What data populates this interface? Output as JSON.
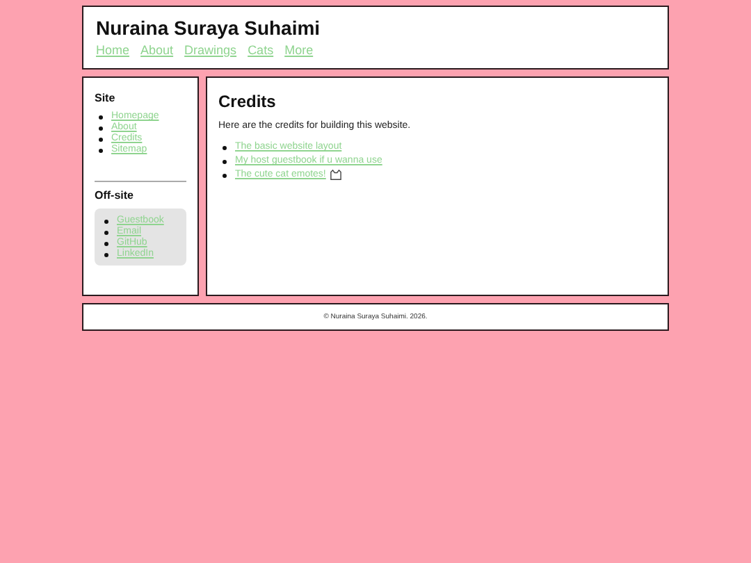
{
  "header": {
    "title": "Nuraina Suraya Suhaimi",
    "nav": [
      "Home",
      "About",
      "Drawings",
      "Cats",
      "More"
    ]
  },
  "sidebar": {
    "sections": [
      {
        "heading": "Site",
        "boxed": false,
        "links": [
          "Homepage",
          "About",
          "Credits",
          "Sitemap"
        ]
      },
      {
        "heading": "Off-site",
        "boxed": true,
        "links": [
          "Guestbook",
          "Email",
          "GitHub",
          "LinkedIn"
        ]
      }
    ]
  },
  "main": {
    "heading": "Credits",
    "intro": "Here are the credits for building this website.",
    "links": [
      {
        "text": "The basic website layout",
        "emote": false
      },
      {
        "text": "My host guestbook if u wanna use",
        "emote": false
      },
      {
        "text": "The cute cat emotes!",
        "emote": true
      }
    ]
  },
  "footer": "© Nuraina Suraya Suhaimi. 2026."
}
